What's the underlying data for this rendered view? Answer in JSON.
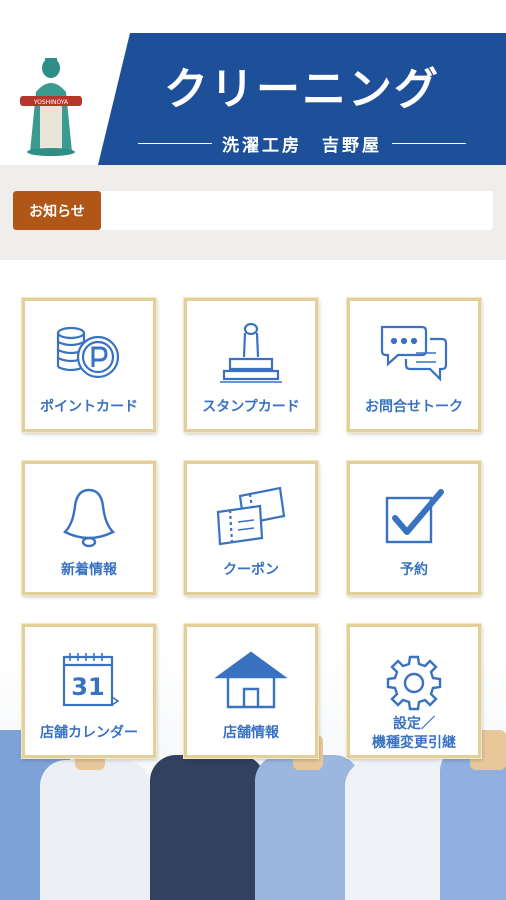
{
  "header": {
    "title": "クリーニング",
    "subtitle": "洗濯工房　吉野屋",
    "brand_color": "#1e4f99",
    "logo_icon": "shop-mascot-logo-icon"
  },
  "notice": {
    "label": "お知らせ",
    "text": "",
    "label_color": "#b05616"
  },
  "menu": {
    "items": [
      {
        "label": "ポイントカード",
        "icon": "points-coins-icon"
      },
      {
        "label": "スタンプカード",
        "icon": "stamp-icon"
      },
      {
        "label": "お問合せトーク",
        "icon": "chat-bubbles-icon"
      },
      {
        "label": "新着情報",
        "icon": "bell-icon"
      },
      {
        "label": "クーポン",
        "icon": "coupon-tickets-icon"
      },
      {
        "label": "予約",
        "icon": "checkbox-icon"
      },
      {
        "label": "店舗カレンダー",
        "icon": "calendar-icon",
        "calendar_day": "31"
      },
      {
        "label": "店舗情報",
        "icon": "store-house-icon"
      },
      {
        "label_line1": "設定／",
        "label_line2": "機種変更引継",
        "icon": "gear-icon"
      }
    ],
    "label_color": "#3a72c2",
    "tile_border_color": "#e3cf99"
  }
}
